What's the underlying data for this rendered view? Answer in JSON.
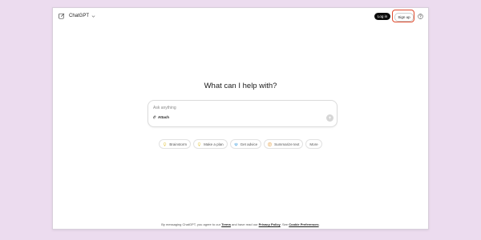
{
  "header": {
    "brand": "ChatGPT",
    "login_label": "Log in",
    "signup_label": "Sign up"
  },
  "main": {
    "headline": "What can I help with?",
    "input_placeholder": "Ask anything",
    "attach_label": "Attach",
    "chips": [
      {
        "label": "Brainstorm",
        "icon": "lightbulb-icon",
        "color": "#e2c541"
      },
      {
        "label": "Make a plan",
        "icon": "lightbulb-icon",
        "color": "#e2c541"
      },
      {
        "label": "Get advice",
        "icon": "graduation-cap-icon",
        "color": "#4aa3df"
      },
      {
        "label": "Summarize text",
        "icon": "document-icon",
        "color": "#e39a3b"
      },
      {
        "label": "More",
        "icon": "",
        "color": ""
      }
    ]
  },
  "footer": {
    "prefix": "By messaging ChatGPT, you agree to our",
    "terms": "Terms",
    "middle": "and have read our",
    "privacy": "Privacy Policy",
    "see": ". See",
    "cookie": "Cookie Preferences",
    "suffix": "."
  },
  "colors": {
    "background": "#ecdcef",
    "login_bg": "#0d0d0d",
    "highlight": "#e04a2c"
  }
}
